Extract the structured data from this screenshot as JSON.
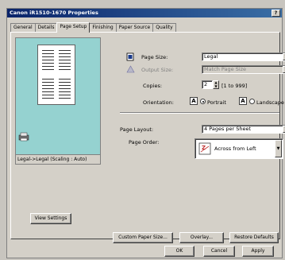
{
  "window": {
    "title": "Canon iR1510-1670 Properties",
    "help_button": "?"
  },
  "tabs": [
    {
      "label": "General",
      "active": false
    },
    {
      "label": "Details",
      "active": false
    },
    {
      "label": "Page Setup",
      "active": true
    },
    {
      "label": "Finishing",
      "active": false
    },
    {
      "label": "Paper Source",
      "active": false
    },
    {
      "label": "Quality",
      "active": false
    }
  ],
  "preview": {
    "status": "Legal->Legal (Scaling : Auto)"
  },
  "page_size": {
    "label": "Page Size:",
    "value": "Legal"
  },
  "output_size": {
    "label": "Output Size:",
    "value": "Match Page Size"
  },
  "copies": {
    "label": "Copies:",
    "value": "2",
    "range": "[1 to 999]"
  },
  "orientation": {
    "label": "Orientation:",
    "portrait": "Portrait",
    "landscape": "Landscape",
    "selected": "portrait"
  },
  "page_layout": {
    "label": "Page Layout:",
    "value": "4 Pages per Sheet"
  },
  "page_order": {
    "label": "Page Order:",
    "value": "Across from Left"
  },
  "buttons": {
    "view_settings": "View Settings",
    "custom_paper": "Custom Paper Size...",
    "overlay": "Overlay...",
    "restore": "Restore Defaults",
    "ok": "OK",
    "cancel": "Cancel",
    "apply": "Apply"
  }
}
